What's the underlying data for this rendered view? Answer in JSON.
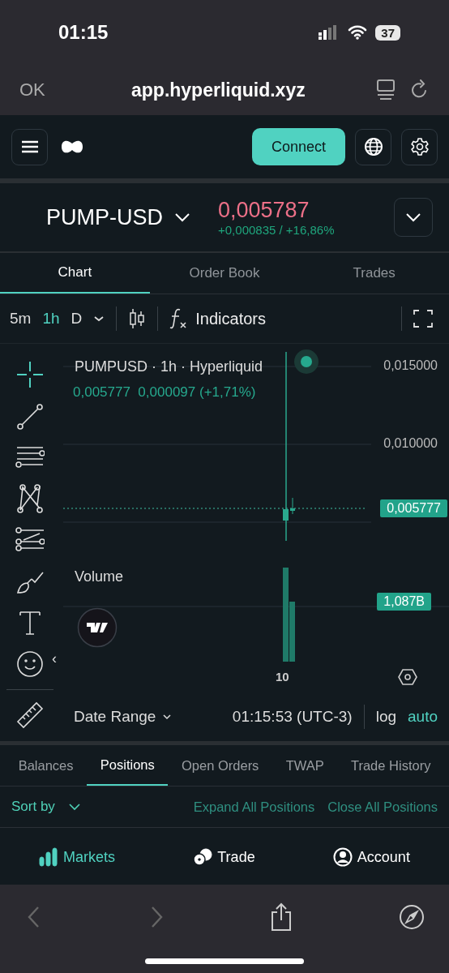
{
  "status_bar": {
    "time": "01:15",
    "battery": "37"
  },
  "browser": {
    "done": "OK",
    "url": "app.hyperliquid.xyz"
  },
  "header": {
    "connect": "Connect"
  },
  "ticker": {
    "symbol": "PUMP-USD",
    "price": "0,005787",
    "change": "+0,000835 / +16,86%"
  },
  "tabs": [
    {
      "label": "Chart",
      "selected": true
    },
    {
      "label": "Order Book",
      "selected": false
    },
    {
      "label": "Trades",
      "selected": false
    }
  ],
  "toolbar": {
    "intervals": [
      {
        "label": "5m",
        "selected": false
      },
      {
        "label": "1h",
        "selected": true
      },
      {
        "label": "D",
        "selected": false
      }
    ],
    "indicators": "Indicators"
  },
  "tools": [
    {
      "kind": "crosshair",
      "selected": true
    },
    {
      "kind": "trendline",
      "selected": false
    },
    {
      "kind": "lines",
      "selected": false
    },
    {
      "kind": "pattern",
      "selected": false
    },
    {
      "kind": "fib",
      "selected": false
    },
    {
      "kind": "brush",
      "selected": false
    },
    {
      "kind": "text",
      "selected": false
    },
    {
      "kind": "emoji",
      "selected": false
    }
  ],
  "collapse_toggle": "‹",
  "chart": {
    "legend": "PUMPUSD · 1h · Hyperliquid",
    "values": "0,005777  0,000097 (+1,71%)",
    "price_labels": [
      "0,015000",
      "0,010000"
    ],
    "last_price": "0,005777",
    "volume_label": "Volume",
    "volume_value": "1,087B",
    "time_label": "10"
  },
  "chart_footer": {
    "date_range": "Date Range",
    "clock": "01:15:53 (UTC-3)",
    "log": "log",
    "auto": "auto"
  },
  "bottom_tabs": [
    {
      "label": "Balances",
      "selected": false
    },
    {
      "label": "Positions",
      "selected": true
    },
    {
      "label": "Open Orders",
      "selected": false
    },
    {
      "label": "TWAP",
      "selected": false
    },
    {
      "label": "Trade History",
      "selected": false
    }
  ],
  "positions_bar": {
    "sort": "Sort by",
    "expand": "Expand All Positions",
    "close": "Close All Positions"
  },
  "nav": [
    {
      "label": "Markets",
      "kind": "markets",
      "selected": true
    },
    {
      "label": "Trade",
      "kind": "trade",
      "selected": false
    },
    {
      "label": "Account",
      "kind": "account",
      "selected": false
    }
  ]
}
